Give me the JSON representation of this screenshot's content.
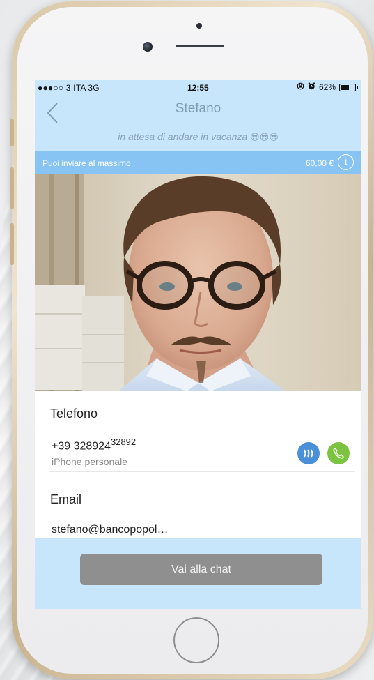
{
  "status_bar": {
    "carrier": "●●●○○ 3 ITA  3G",
    "time": "12:55",
    "battery": "62%",
    "battery_level": 0.62
  },
  "nav": {
    "title": "Stefano",
    "back_icon": "chevron-left-icon"
  },
  "profile": {
    "status_message": "in attesa di andare in vacanza",
    "status_emoji": "😎😎😎"
  },
  "limit_bar": {
    "label": "Puoi inviare al massimo",
    "amount": "60,00 €",
    "info_icon": "info-icon"
  },
  "contact": {
    "phone_label": "Telefono",
    "phone_number": "+39 328924",
    "phone_number_overlay": "32892",
    "phone_type": "iPhone personale",
    "email_label": "Email",
    "email_value": "stefano@bancopopol…"
  },
  "colors": {
    "header_bg": "#c7e6fb",
    "limit_bar_bg": "#87c4f3",
    "jiffy_button": "#4a90d9",
    "call_button": "#7cc43f",
    "chat_button": "#8f8f8f"
  },
  "footer": {
    "chat_button_label": "Vai alla chat"
  }
}
